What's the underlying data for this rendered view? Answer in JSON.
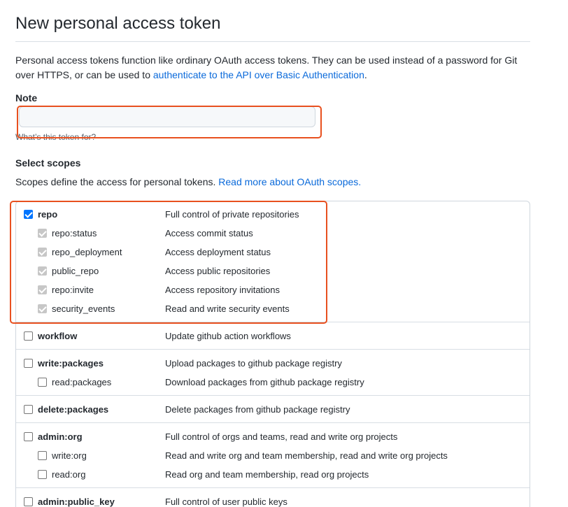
{
  "page": {
    "title": "New personal access token",
    "intro_text": "Personal access tokens function like ordinary OAuth access tokens. They can be used instead of a password for Git over HTTPS, or can be used to ",
    "intro_link": "authenticate to the API over Basic Authentication",
    "intro_end": "."
  },
  "note": {
    "label": "Note",
    "value": "",
    "placeholder": "",
    "hint": "What’s this token for?"
  },
  "scopes": {
    "title": "Select scopes",
    "description": "Scopes define the access for personal tokens. ",
    "description_link": "Read more about OAuth scopes.",
    "groups": [
      {
        "items": [
          {
            "name": "repo",
            "desc": "Full control of private repositories",
            "state": "checked"
          },
          {
            "name": "repo:status",
            "desc": "Access commit status",
            "state": "checked-disabled"
          },
          {
            "name": "repo_deployment",
            "desc": "Access deployment status",
            "state": "checked-disabled"
          },
          {
            "name": "public_repo",
            "desc": "Access public repositories",
            "state": "checked-disabled"
          },
          {
            "name": "repo:invite",
            "desc": "Access repository invitations",
            "state": "checked-disabled"
          },
          {
            "name": "security_events",
            "desc": "Read and write security events",
            "state": "checked-disabled"
          }
        ]
      },
      {
        "items": [
          {
            "name": "workflow",
            "desc": "Update github action workflows",
            "state": "unchecked"
          }
        ]
      },
      {
        "items": [
          {
            "name": "write:packages",
            "desc": "Upload packages to github package registry",
            "state": "unchecked"
          },
          {
            "name": "read:packages",
            "desc": "Download packages from github package registry",
            "state": "unchecked"
          }
        ]
      },
      {
        "items": [
          {
            "name": "delete:packages",
            "desc": "Delete packages from github package registry",
            "state": "unchecked"
          }
        ]
      },
      {
        "items": [
          {
            "name": "admin:org",
            "desc": "Full control of orgs and teams, read and write org projects",
            "state": "unchecked"
          },
          {
            "name": "write:org",
            "desc": "Read and write org and team membership, read and write org projects",
            "state": "unchecked"
          },
          {
            "name": "read:org",
            "desc": "Read org and team membership, read org projects",
            "state": "unchecked"
          }
        ]
      },
      {
        "items": [
          {
            "name": "admin:public_key",
            "desc": "Full control of user public keys",
            "state": "unchecked"
          }
        ]
      }
    ]
  },
  "colors": {
    "link": "#0969da",
    "checkbox_checked": "#0075ff",
    "checkbox_disabled": "#c7c7c7",
    "highlight": "#e8501f"
  }
}
